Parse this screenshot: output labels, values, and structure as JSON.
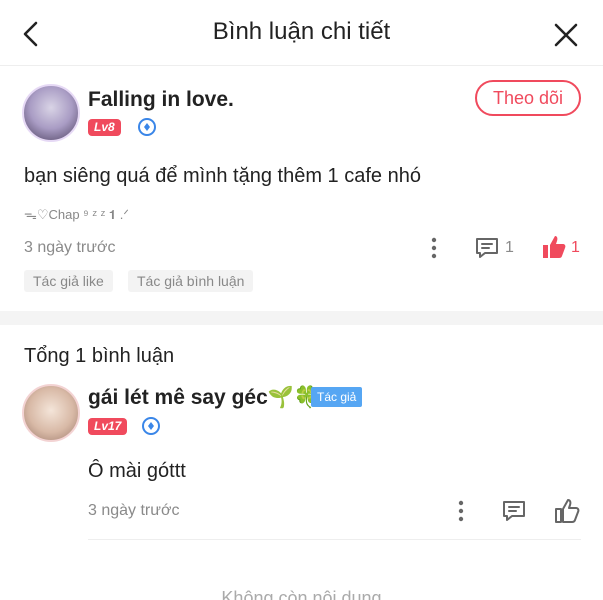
{
  "header": {
    "title": "Bình luận chi tiết"
  },
  "main_comment": {
    "username": "Falling in love.",
    "level": "Lv8",
    "follow_label": "Theo dõi",
    "text": "bạn siêng quá để mình tặng thêm 1 cafe nhó",
    "chapter": "ᯓ♡Chap ⁹ ᶻ ᶻ 𝟏 .ᐟ",
    "time": "3 ngày trước",
    "reply_count": "1",
    "like_count": "1",
    "tags": [
      "Tác giả like",
      "Tác giả bình luận"
    ]
  },
  "replies_section": {
    "total_label": "Tổng 1 bình luận"
  },
  "reply": {
    "username": "gái lét mê say géc🌱🍀",
    "author_badge": "Tác giả",
    "level": "Lv17",
    "text": "Ô mài góttt",
    "time": "3 ngày trước"
  },
  "footer": {
    "end_text": "Không còn nội dung"
  },
  "colors": {
    "accent": "#f04a5d",
    "author_badge": "#56a6f3",
    "verified": "#3a86e8"
  }
}
